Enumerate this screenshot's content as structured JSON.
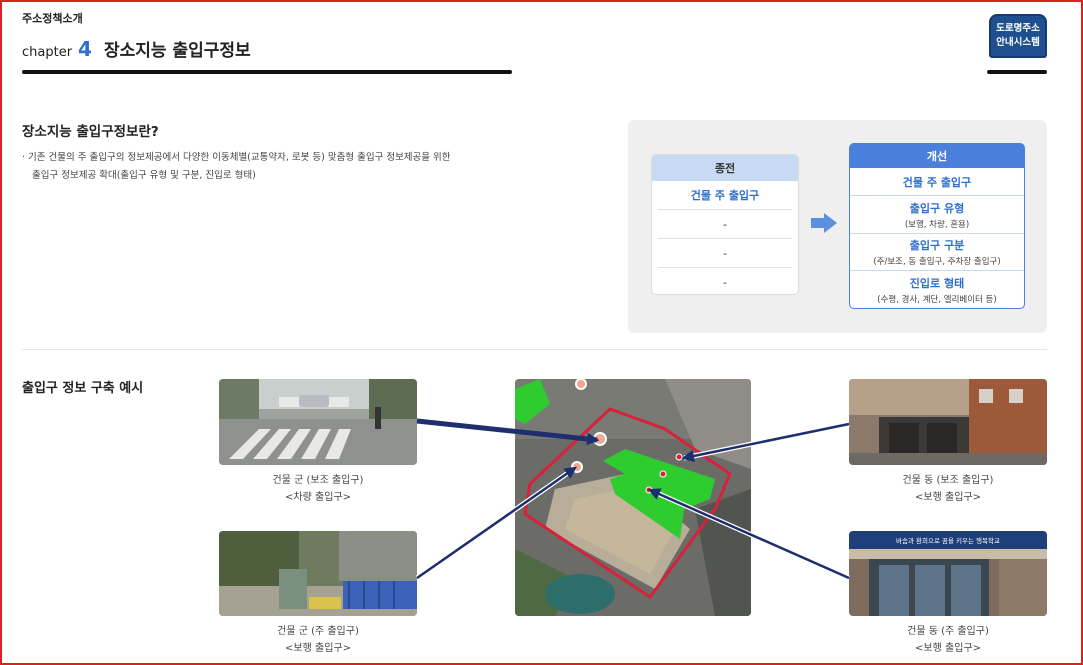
{
  "header": {
    "section": "주소정책소개",
    "chapter_word": "chapter",
    "chapter_num": "4",
    "chapter_title": "장소지능 출입구정보",
    "logo_line1": "도로명주소",
    "logo_line2": "안내시스템"
  },
  "definition": {
    "title": "장소지능 출입구정보란?",
    "line1": "· 기존 건물의 주 출입구의 정보제공에서 다양한 이동체별(교통약자, 로봇 등) 맞춤형 출입구 정보제공을 위한",
    "line2": "출입구 정보제공 확대(출입구 유형 및 구분,  진입로 형태)"
  },
  "compare": {
    "old_header": "종전",
    "old_rows": [
      "건물 주 출입구",
      "-",
      "-",
      "-"
    ],
    "new_header": "개선",
    "new_rows": [
      {
        "label": "건물 주 출입구",
        "sub": ""
      },
      {
        "label": "출입구 유형",
        "sub": "(보행, 차량, 혼용)"
      },
      {
        "label": "출입구 구분",
        "sub": "(주/보조, 동 출입구, 주차장 출입구)"
      },
      {
        "label": "진입로 형태",
        "sub": "(수평, 경사, 계단, 엘리베이터 등)"
      }
    ],
    "arrow_color": "#5b8fe0"
  },
  "example": {
    "title": "출입구 정보 구축 예시",
    "photos": [
      {
        "caption1": "건물 군 (보조 출입구)",
        "caption2": "<차량 출입구>"
      },
      {
        "caption1": "건물 군 (주 출입구)",
        "caption2": "<보행 출입구>"
      },
      {
        "caption1": "건물 동 (보조 출입구)",
        "caption2": "<보행 출입구>"
      },
      {
        "caption1": "건물 동 (주 출입구)",
        "caption2": "<보행 출입구>"
      }
    ],
    "sign_text": "바솜과 환희으로 꿈을 키우는 행복학교",
    "arrow_color": "#1e2f6e",
    "boundary_color": "#d8213a",
    "building_color": "#2ecc2e"
  },
  "colors": {
    "accent": "#2f6fd0",
    "frame": "#e02020"
  }
}
